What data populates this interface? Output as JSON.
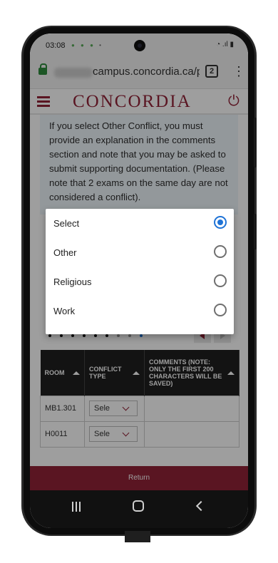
{
  "status_bar": {
    "time": "03:08"
  },
  "browser": {
    "url": "campus.concordia.ca/ps",
    "tab_count": "2"
  },
  "app": {
    "brand": "CONCORDIA"
  },
  "notice": {
    "text": "If you select Other Conflict, you must provide an explanation in the comments section and note that you may be asked to submit supporting documentation. (Please note that 2 exams on the same day are not considered a conflict)."
  },
  "table": {
    "headers": [
      "ROOM",
      "CONFLICT TYPE",
      "COMMENTS (NOTE: ONLY THE FIRST 200 CHARACTERS WILL BE SAVED)"
    ],
    "rows": [
      {
        "room": "MB1.301",
        "conflict": "Sele"
      },
      {
        "room": "H0011",
        "conflict": "Sele"
      }
    ]
  },
  "footer": {
    "return_label": "Return"
  },
  "dialog": {
    "options": [
      {
        "label": "Select",
        "selected": true
      },
      {
        "label": "Other",
        "selected": false
      },
      {
        "label": "Religious",
        "selected": false
      },
      {
        "label": "Work",
        "selected": false
      }
    ]
  },
  "colors": {
    "brand": "#912338",
    "radio_selected": "#1f73d6"
  }
}
